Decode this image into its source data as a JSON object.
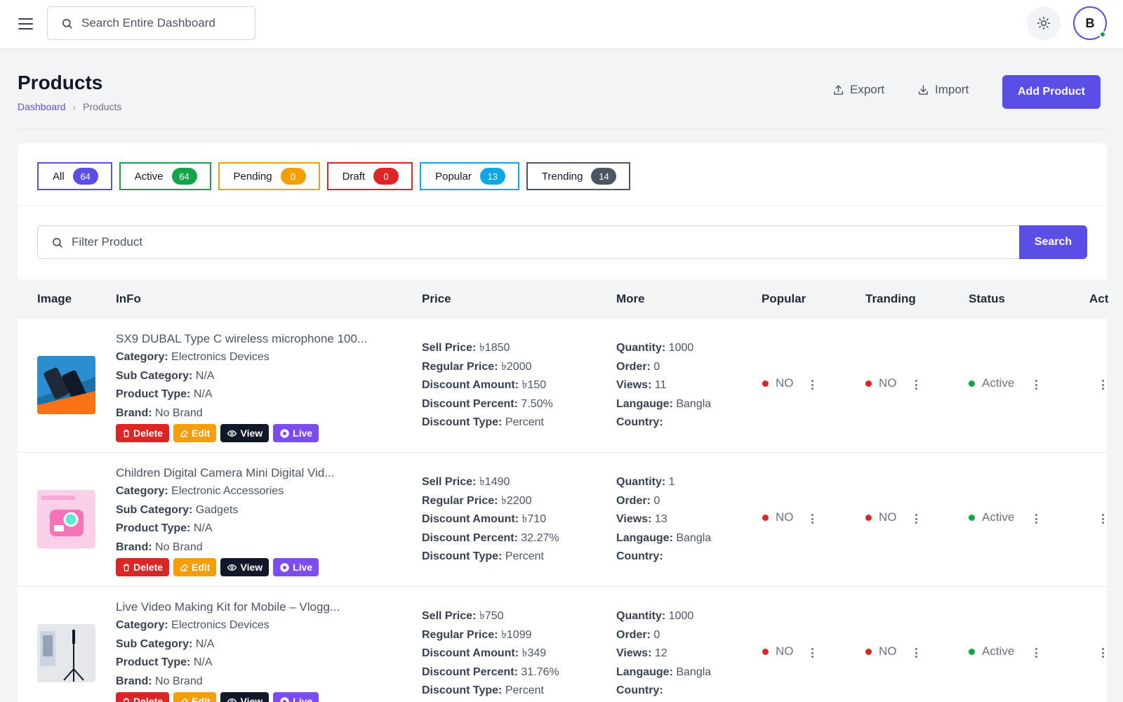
{
  "topbar": {
    "search_placeholder": "Search Entire Dashboard",
    "avatar_initial": "B"
  },
  "header": {
    "title": "Products",
    "breadcrumb": [
      "Dashboard",
      "Products"
    ],
    "export_label": "Export",
    "import_label": "Import",
    "add_label": "Add Product"
  },
  "tabs": [
    {
      "label": "All",
      "count": "64",
      "color": "#5b4ee6"
    },
    {
      "label": "Active",
      "count": "64",
      "color": "#16a34a"
    },
    {
      "label": "Pending",
      "count": "0",
      "color": "#f59e0b"
    },
    {
      "label": "Draft",
      "count": "0",
      "color": "#dc2626"
    },
    {
      "label": "Popular",
      "count": "13",
      "color": "#0ea5e9"
    },
    {
      "label": "Trending",
      "count": "14",
      "color": "#4b5563"
    }
  ],
  "filter": {
    "placeholder": "Filter Product",
    "search_label": "Search"
  },
  "table": {
    "columns": [
      "Image",
      "InFo",
      "Price",
      "More",
      "Popular",
      "Tranding",
      "Status",
      "Act"
    ],
    "labels": {
      "category": "Category:",
      "sub_category": "Sub Category:",
      "product_type": "Product Type:",
      "brand": "Brand:",
      "sell_price": "Sell Price:",
      "regular_price": "Regular Price:",
      "discount_amount": "Discount Amount:",
      "discount_percent": "Discount Percent:",
      "discount_type": "Discount Type:",
      "quantity": "Quantity:",
      "order": "Order:",
      "views": "Views:",
      "language": "Langauge:",
      "country": "Country:"
    },
    "actions": {
      "delete": "Delete",
      "edit": "Edit",
      "view": "View",
      "live": "Live"
    },
    "rows": [
      {
        "name": "SX9 DUBAL Type C wireless microphone 100...",
        "category": "Electronics Devices",
        "sub_category": "N/A",
        "product_type": "N/A",
        "brand": "No Brand",
        "sell_price": "৳1850",
        "regular_price": "৳2000",
        "discount_amount": "৳150",
        "discount_percent": "7.50%",
        "discount_type": "Percent",
        "quantity": "1000",
        "order": "0",
        "views": "11",
        "language": "Bangla",
        "country": "",
        "popular": "NO",
        "trending": "NO",
        "status": "Active"
      },
      {
        "name": "Children Digital Camera Mini Digital Vid...",
        "category": "Electronic Accessories",
        "sub_category": "Gadgets",
        "product_type": "N/A",
        "brand": "No Brand",
        "sell_price": "৳1490",
        "regular_price": "৳2200",
        "discount_amount": "৳710",
        "discount_percent": "32.27%",
        "discount_type": "Percent",
        "quantity": "1",
        "order": "0",
        "views": "13",
        "language": "Bangla",
        "country": "",
        "popular": "NO",
        "trending": "NO",
        "status": "Active"
      },
      {
        "name": "Live Video Making Kit for Mobile – Vlogg...",
        "category": "Electronics Devices",
        "sub_category": "N/A",
        "product_type": "N/A",
        "brand": "No Brand",
        "sell_price": "৳750",
        "regular_price": "৳1099",
        "discount_amount": "৳349",
        "discount_percent": "31.76%",
        "discount_type": "Percent",
        "quantity": "1000",
        "order": "0",
        "views": "12",
        "language": "Bangla",
        "country": "",
        "popular": "NO",
        "trending": "NO",
        "status": "Active"
      }
    ]
  }
}
